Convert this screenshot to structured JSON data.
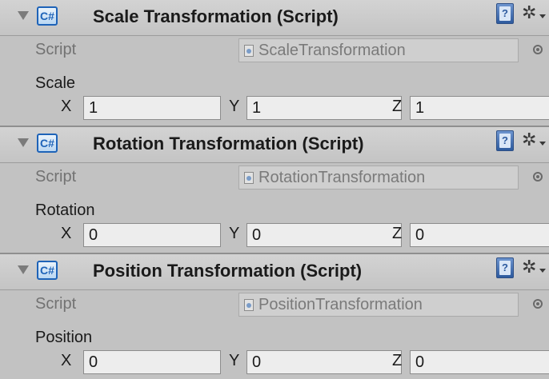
{
  "components": [
    {
      "title": "Scale Transformation (Script)",
      "script_label": "Script",
      "script_value": "ScaleTransformation",
      "vector_label": "Scale",
      "x_label": "X",
      "x_value": "1",
      "y_label": "Y",
      "y_value": "1",
      "z_label": "Z",
      "z_value": "1"
    },
    {
      "title": "Rotation Transformation (Script)",
      "script_label": "Script",
      "script_value": "RotationTransformation",
      "vector_label": "Rotation",
      "x_label": "X",
      "x_value": "0",
      "y_label": "Y",
      "y_value": "0",
      "z_label": "Z",
      "z_value": "0"
    },
    {
      "title": "Position Transformation (Script)",
      "script_label": "Script",
      "script_value": "PositionTransformation",
      "vector_label": "Position",
      "x_label": "X",
      "x_value": "0",
      "y_label": "Y",
      "y_value": "0",
      "z_label": "Z",
      "z_value": "0"
    }
  ],
  "icons": {
    "foldout": "foldout-arrow-icon",
    "script": "csharp-script-icon",
    "help": "help-book-icon",
    "settings": "gear-icon",
    "object_picker": "object-picker-icon"
  },
  "icon_glyphs": {
    "csharp": "C#",
    "help": "?",
    "gear": "✲"
  },
  "colors": {
    "panel_bg": "#c2c2c2",
    "header_bg": "#c9c9c9",
    "field_bg": "#ededed",
    "script_field_bg": "#cfcfcf",
    "accent_blue": "#1e63b8",
    "disabled_text": "#727272"
  }
}
